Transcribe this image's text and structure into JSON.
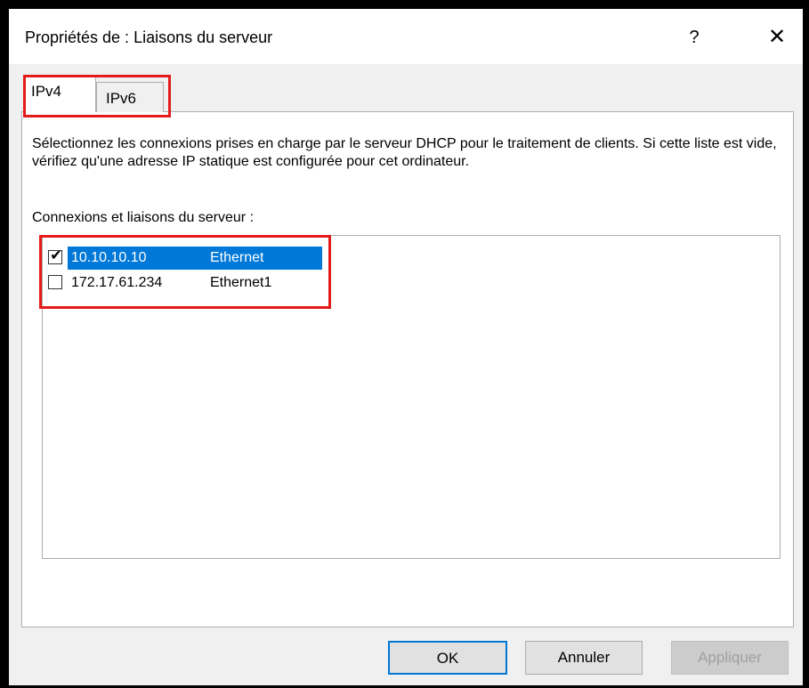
{
  "window": {
    "title": "Propriétés de : Liaisons du serveur",
    "help_label": "?",
    "close_label": "✕"
  },
  "tabs": [
    {
      "label": "IPv4",
      "active": true
    },
    {
      "label": "IPv6",
      "active": false
    }
  ],
  "panel": {
    "description": "Sélectionnez les connexions prises en charge par le serveur DHCP pour le traitement de clients. Si cette liste est vide, vérifiez qu'une adresse IP statique est configurée pour cet ordinateur.",
    "list_label": "Connexions et liaisons du serveur :"
  },
  "connections": [
    {
      "ip": "10.10.10.10",
      "interface": "Ethernet",
      "checked": true,
      "selected": true
    },
    {
      "ip": "172.17.61.234",
      "interface": "Ethernet1",
      "checked": false,
      "selected": false
    }
  ],
  "buttons": {
    "ok": "OK",
    "cancel": "Annuler",
    "apply": "Appliquer"
  },
  "colors": {
    "selection": "#0078d7",
    "highlight_border": "#e31b1b",
    "disabled_text": "#a0a0a0"
  }
}
